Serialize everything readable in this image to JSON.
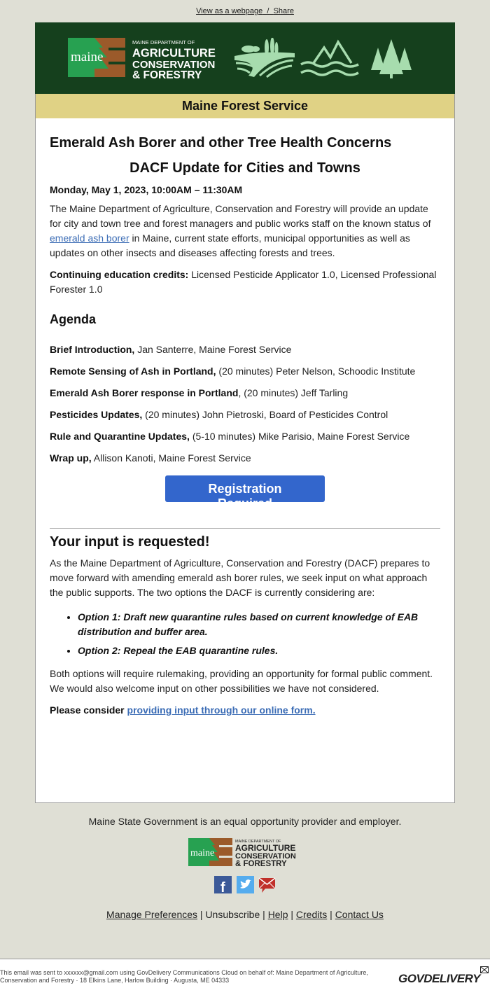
{
  "topbar": {
    "view_webpage": "View as a webpage",
    "separator": "/",
    "share": "Share"
  },
  "header": {
    "logo": {
      "wordmark": "maine",
      "dept_line": "MAINE DEPARTMENT OF",
      "line1": "AGRICULTURE",
      "line2": "CONSERVATION",
      "line3": "& FORESTRY"
    },
    "icons": [
      "farm-fields-icon",
      "mountain-water-icon",
      "pine-trees-icon"
    ],
    "band_title": "Maine Forest Service"
  },
  "colors": {
    "header_bg": "#15401d",
    "band_bg": "#e0d285",
    "button_bg": "#3366cc",
    "link": "#3b6cb5",
    "page_bg": "#dfdfd5"
  },
  "main": {
    "title": "Emerald Ash Borer and other Tree Health Concerns",
    "subtitle": "DACF Update for Cities and Towns",
    "date": "Monday, May 1, 2023, 10:00AM – 11:30AM",
    "intro_before": "The Maine Department of Agriculture, Conservation and Forestry will provide an update for city and town tree and forest managers and public works staff on the known status of ",
    "intro_link": "emerald ash borer",
    "intro_after": " in Maine, current state efforts, municipal opportunities as well as updates on other insects and diseases affecting forests and trees.",
    "credits_label": "Continuing education credits:",
    "credits_text": " Licensed Pesticide Applicator 1.0, Licensed Professional Forester 1.0",
    "agenda_title": "Agenda",
    "agenda": [
      {
        "title": "Brief Introduction,",
        "detail": " Jan Santerre, Maine Forest Service"
      },
      {
        "title": "Remote Sensing of Ash in Portland,",
        "detail": " (20 minutes) Peter Nelson, Schoodic Institute"
      },
      {
        "title": "Emerald Ash Borer response in Portland",
        "detail": ", (20 minutes) Jeff Tarling"
      },
      {
        "title": "Pesticides Updates,",
        "detail": " (20 minutes) John Pietroski, Board of Pesticides Control"
      },
      {
        "title": "Rule and Quarantine Updates,",
        "detail": " (5-10 minutes) Mike Parisio, Maine Forest Service"
      },
      {
        "title": "Wrap up,",
        "detail": " Allison Kanoti, Maine Forest Service"
      }
    ],
    "register_button": "Registration Required",
    "input_title": "Your input is requested!",
    "input_body": "As the Maine Department of Agriculture, Conservation and Forestry (DACF) prepares to move forward with amending emerald ash borer rules, we seek input on what approach the public supports. The two options the DACF is currently considering are:",
    "options": [
      "Option 1: Draft new quarantine rules based on current knowledge of EAB distribution and buffer area.",
      "Option 2: Repeal the EAB quarantine rules."
    ],
    "both_options": "Both options will require rulemaking, providing an opportunity for formal public comment. We would also welcome input on other possibilities we have not considered.",
    "consider_label": "Please consider ",
    "consider_link": "providing input through our online form."
  },
  "footer": {
    "equal_opportunity": "Maine State Government is an equal opportunity provider and employer.",
    "social": [
      "facebook-icon",
      "twitter-icon",
      "email-icon"
    ],
    "links": {
      "manage": "Manage Preferences",
      "unsubscribe": "Unsubscribe",
      "help": "Help",
      "credits": "Credits",
      "contact": "Contact Us",
      "sep": " | "
    }
  },
  "bottom": {
    "line1": "This email was sent to xxxxxx@gmail.com using GovDelivery Communications Cloud on behalf of: Maine Department of Agriculture,",
    "line2": "Conservation and Forestry · 18 Elkins Lane, Harlow Building · Augusta, ME 04333",
    "brand": "GOVDELIVERY"
  }
}
